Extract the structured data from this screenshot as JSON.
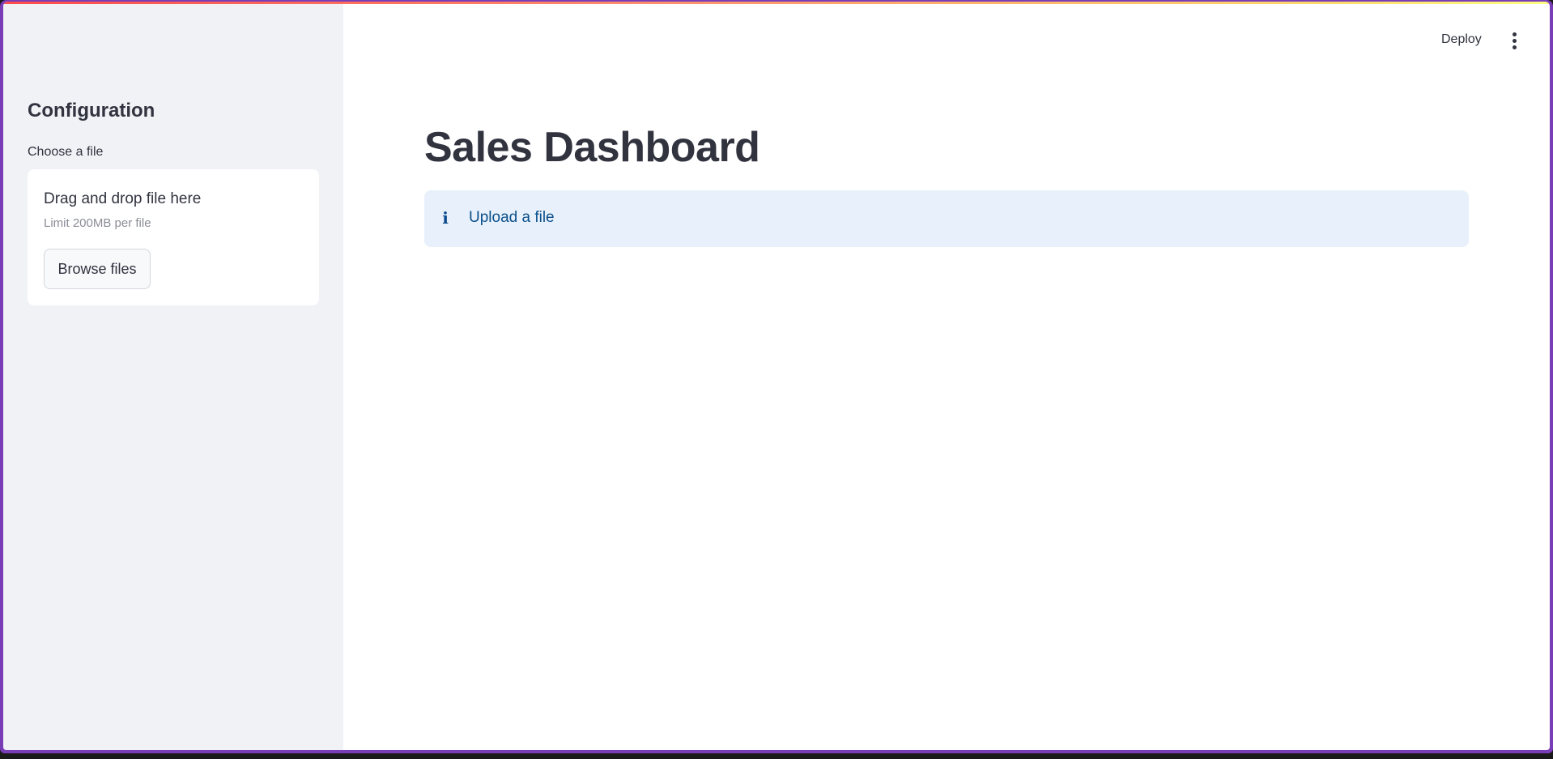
{
  "header": {
    "deploy_label": "Deploy",
    "menu_icon": "more-vertical-icon"
  },
  "sidebar": {
    "title": "Configuration",
    "file_uploader": {
      "label": "Choose a file",
      "dropzone_title": "Drag and drop file here",
      "limit_text": "Limit 200MB per file",
      "browse_label": "Browse files"
    }
  },
  "main": {
    "title": "Sales Dashboard",
    "info_alert": {
      "icon": "info-icon",
      "message": "Upload a file"
    }
  },
  "colors": {
    "window_frame": "#7a3db8",
    "sidebar_bg": "#f0f2f6",
    "text_primary": "#31333f",
    "info_bg": "#e8f1fb",
    "info_text": "#0b4f8a"
  }
}
